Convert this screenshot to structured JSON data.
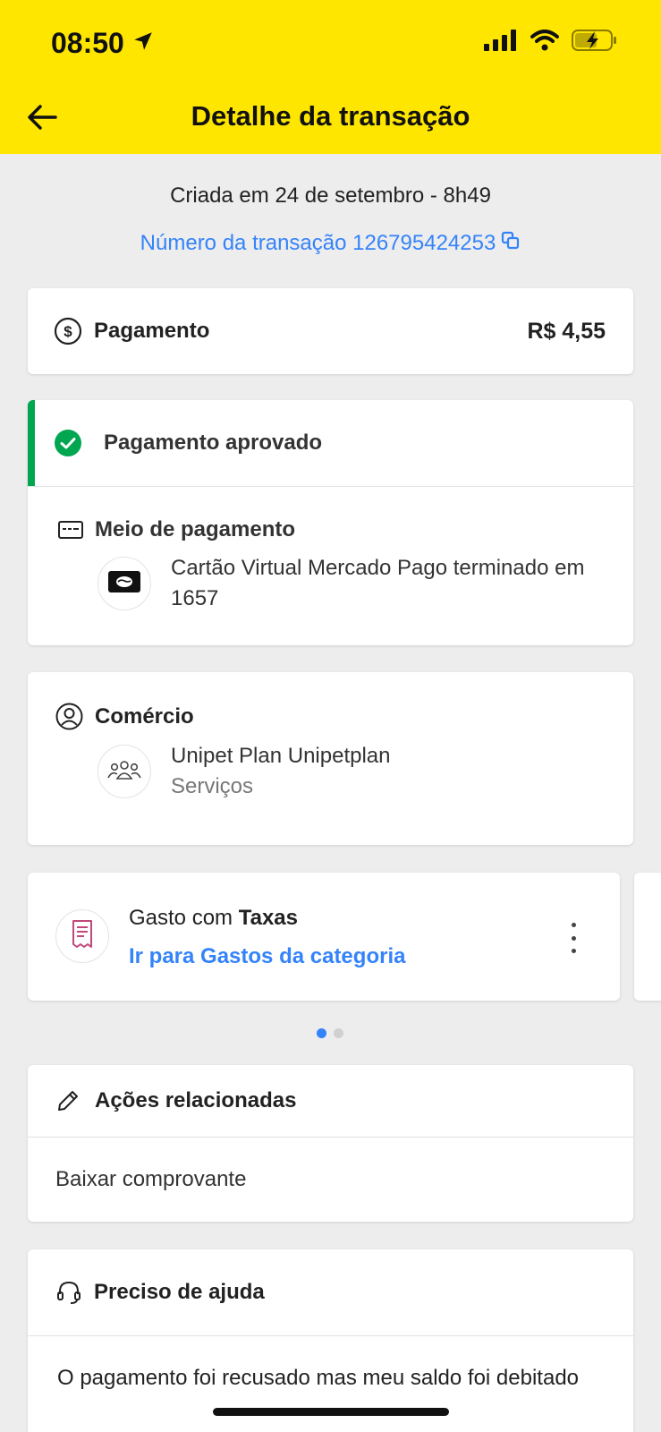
{
  "status_bar": {
    "time": "08:50"
  },
  "header": {
    "title": "Detalhe da transação"
  },
  "created_text": "Criada em 24 de setembro - 8h49",
  "transaction_number_label": "Número da transação 126795424253",
  "payment": {
    "label": "Pagamento",
    "amount": "R$ 4,55"
  },
  "status": {
    "label": "Pagamento aprovado",
    "color": "#00a650"
  },
  "payment_method": {
    "title": "Meio de pagamento",
    "description": "Cartão Virtual Mercado Pago terminado em 1657"
  },
  "merchant": {
    "title": "Comércio",
    "name": "Unipet Plan Unipetplan",
    "category": "Serviços"
  },
  "spending": {
    "prefix": "Gasto com ",
    "category": "Taxas",
    "link": "Ir para Gastos da categoria"
  },
  "pager": {
    "active_index": 0,
    "count": 2
  },
  "related_actions": {
    "title": "Ações relacionadas",
    "items": [
      "Baixar comprovante"
    ]
  },
  "help": {
    "title": "Preciso de ajuda",
    "items": [
      "O pagamento foi recusado mas meu saldo foi debitado"
    ]
  },
  "colors": {
    "header_bg": "#ffe600",
    "link": "#3483fa",
    "page_bg": "#ededed"
  }
}
